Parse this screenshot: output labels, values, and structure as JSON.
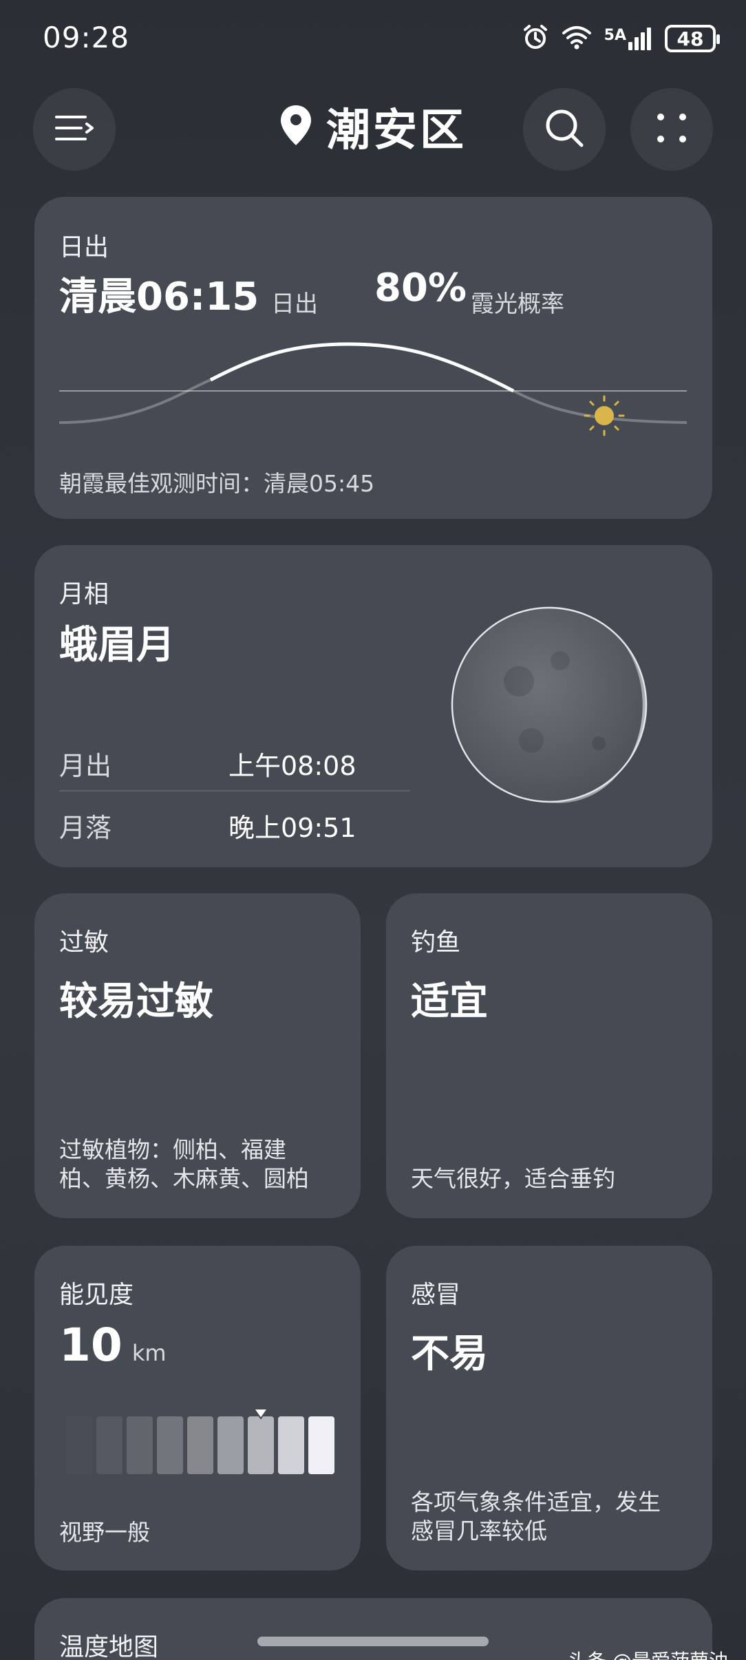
{
  "status": {
    "time": "09:28",
    "network": "5A",
    "battery": "48",
    "icons": [
      "alarm-icon",
      "wifi-icon",
      "signal-icon",
      "battery-icon"
    ]
  },
  "header": {
    "location": "潮安区",
    "icons": [
      "menu-icon",
      "location-pin-icon",
      "search-icon",
      "more-icon"
    ]
  },
  "sunrise": {
    "label": "日出",
    "time": "清晨06:15",
    "time_suffix": "日出",
    "probability": "80%",
    "probability_label": "霞光概率",
    "best_view": "朝霞最佳观测时间：清晨05:45"
  },
  "moon": {
    "label": "月相",
    "phase": "蛾眉月",
    "rise_label": "月出",
    "rise_time": "上午08:08",
    "set_label": "月落",
    "set_time": "晚上09:51"
  },
  "allergy": {
    "label": "过敏",
    "value": "较易过敏",
    "desc_line1": "过敏植物：侧柏、福建",
    "desc_line2": "柏、黄杨、木麻黄、圆柏"
  },
  "fishing": {
    "label": "钓鱼",
    "value": "适宜",
    "desc": "天气很好，适合垂钓"
  },
  "visibility": {
    "label": "能见度",
    "value": "10",
    "unit": "km",
    "desc": "视野一般",
    "level_index": 6,
    "segments": 9
  },
  "cold": {
    "label": "感冒",
    "value": "不易",
    "desc_line1": "各项气象条件适宜，发生",
    "desc_line2": "感冒几率较低"
  },
  "temp_map": {
    "label": "温度地图"
  },
  "watermark": "头条 @最爱菠萝油"
}
